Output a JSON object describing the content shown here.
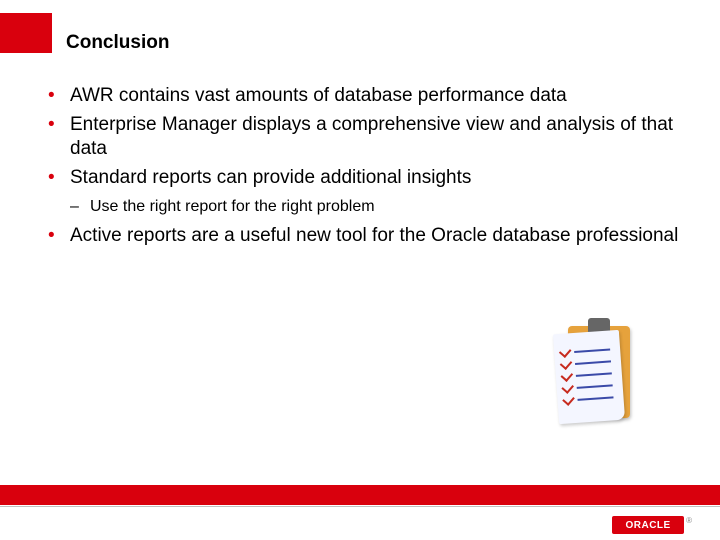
{
  "title": "Conclusion",
  "bullets": {
    "b1": "AWR contains vast amounts of database performance data",
    "b2": "Enterprise Manager displays a comprehensive view and analysis of that data",
    "b3": "Standard reports can provide additional insights",
    "b3_sub1": "Use the right report for the right problem",
    "b4": "Active reports are a useful new tool for the Oracle database professional"
  },
  "logo_text": "ORACLE",
  "logo_r": "®"
}
